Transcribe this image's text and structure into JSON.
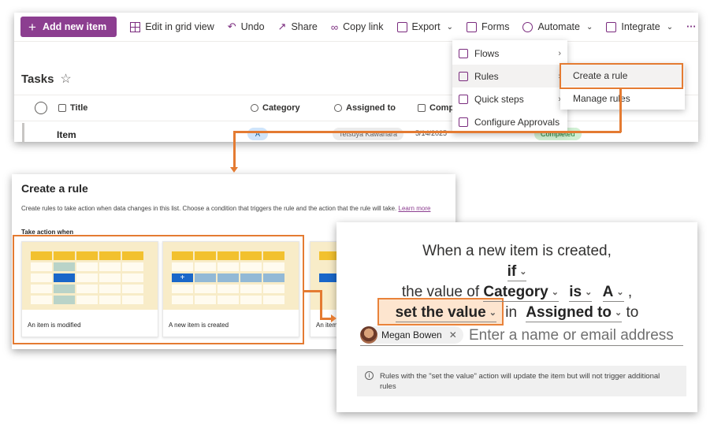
{
  "toolbar": {
    "add_new_item": "Add new item",
    "edit_grid": "Edit in grid view",
    "undo": "Undo",
    "share": "Share",
    "copy_link": "Copy link",
    "export": "Export",
    "forms": "Forms",
    "automate": "Automate",
    "integrate": "Integrate",
    "more": "···"
  },
  "list": {
    "title": "Tasks",
    "columns": [
      "Title",
      "Category",
      "Assigned to",
      "Compl"
    ],
    "item": {
      "title": "Item",
      "category": "A",
      "assigned_to": "Tetsuya Kawahara",
      "date": "5/14/2025",
      "status": "Completed"
    }
  },
  "automate_menu": {
    "items": [
      "Flows",
      "Rules",
      "Quick steps",
      "Configure Approvals"
    ],
    "rules_submenu": [
      "Create a rule",
      "Manage rules"
    ]
  },
  "create_rule": {
    "title": "Create a rule",
    "description": "Create rules to take action when data changes in this list. Choose a condition that triggers the rule and the action that the rule will take.",
    "learn_more": "Learn more",
    "take_action_label": "Take action when",
    "cards": [
      "An item is modified",
      "A new item is created",
      "An item"
    ]
  },
  "rule_sentence": {
    "line1": "When a new item is created,",
    "if": "if",
    "value_of": "the value of",
    "field": "Category",
    "operator": "is",
    "value": "A",
    "comma": ",",
    "action": "set the value",
    "in": "in",
    "target_field": "Assigned to",
    "to": "to",
    "person": "Megan Bowen",
    "email_placeholder": "Enter a name or email address",
    "info": "Rules with the \"set the value\" action will update the item but will not trigger additional rules"
  },
  "colors": {
    "brand": "#8c3e90",
    "callout": "#e47b32"
  }
}
